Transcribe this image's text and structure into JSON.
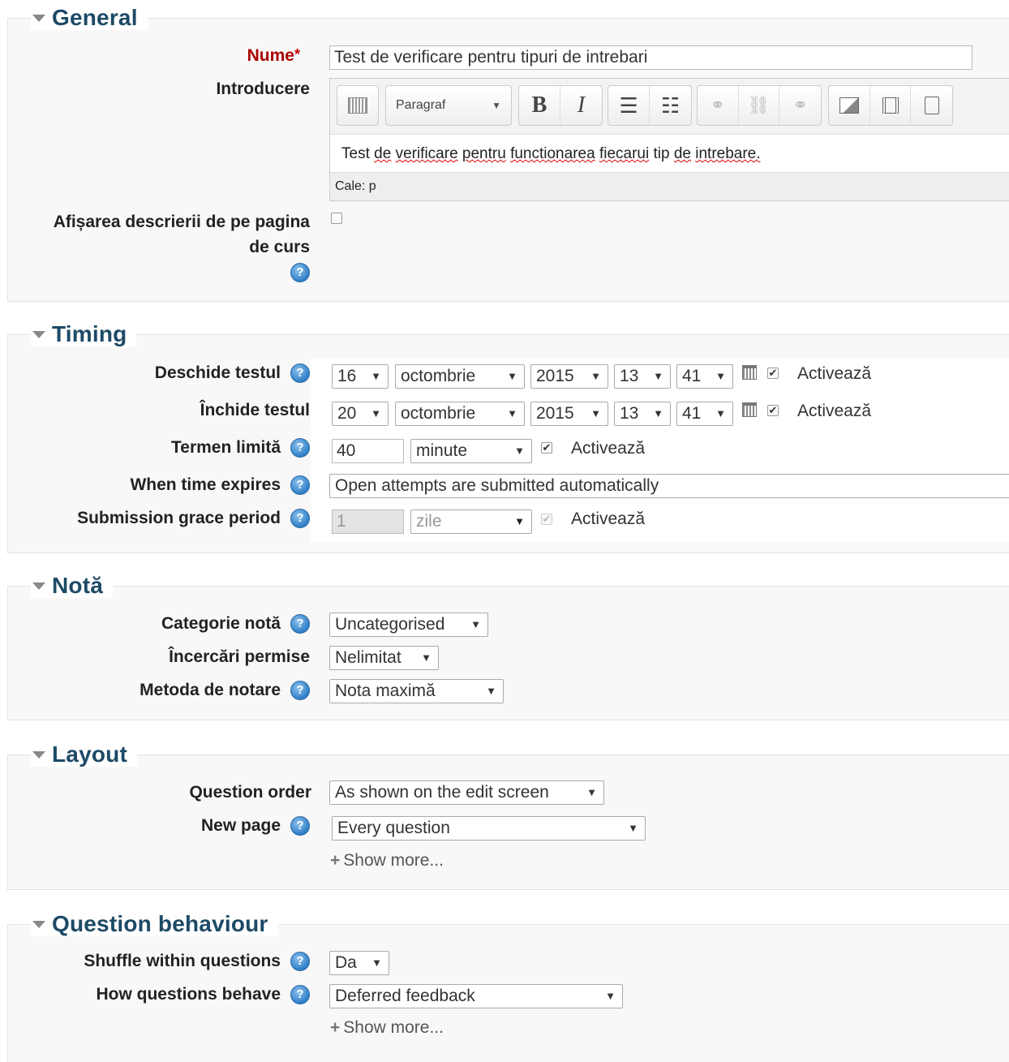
{
  "sections": {
    "general": {
      "title": "General",
      "name_label": "Nume",
      "name_required": "*",
      "name_value": "Test de verificare pentru tipuri de intrebari",
      "intro_label": "Introducere",
      "editor": {
        "format": "Paragraf",
        "content_words": [
          "Test",
          "de",
          "verificare",
          "pentru",
          "functionarea",
          "fiecarui",
          "tip",
          "de",
          "intrebare."
        ],
        "path": "Cale: p"
      },
      "show_desc_label_1": "Afișarea descrierii de pe pagina",
      "show_desc_label_2": "de curs",
      "help": "?"
    },
    "timing": {
      "title": "Timing",
      "open_label": "Deschide testul",
      "open": {
        "day": "16",
        "month": "octombrie",
        "year": "2015",
        "hour": "13",
        "minute": "41",
        "enable": "Activează"
      },
      "close_label": "Închide testul",
      "close": {
        "day": "20",
        "month": "octombrie",
        "year": "2015",
        "hour": "13",
        "minute": "41",
        "enable": "Activează"
      },
      "limit_label": "Termen limită",
      "limit_value": "40",
      "limit_unit": "minute",
      "limit_enable": "Activează",
      "expires_label": "When time expires",
      "expires_value": "Open attempts are submitted automatically",
      "grace_label": "Submission grace period",
      "grace_value": "1",
      "grace_unit": "zile",
      "grace_enable": "Activează"
    },
    "grade": {
      "title": "Notă",
      "category_label": "Categorie notă",
      "category_value": "Uncategorised",
      "attempts_label": "Încercări permise",
      "attempts_value": "Nelimitat",
      "method_label": "Metoda de notare",
      "method_value": "Nota maximă"
    },
    "layout": {
      "title": "Layout",
      "order_label": "Question order",
      "order_value": "As shown on the edit screen",
      "newpage_label": "New page",
      "newpage_value": "Every question",
      "show_more": "Show more..."
    },
    "behaviour": {
      "title": "Question behaviour",
      "shuffle_label": "Shuffle within questions",
      "shuffle_value": "Da",
      "behave_label": "How questions behave",
      "behave_value": "Deferred feedback",
      "show_more": "Show more..."
    }
  },
  "icons": {
    "arrow": "▼",
    "check": "✔",
    "plus": "+"
  }
}
